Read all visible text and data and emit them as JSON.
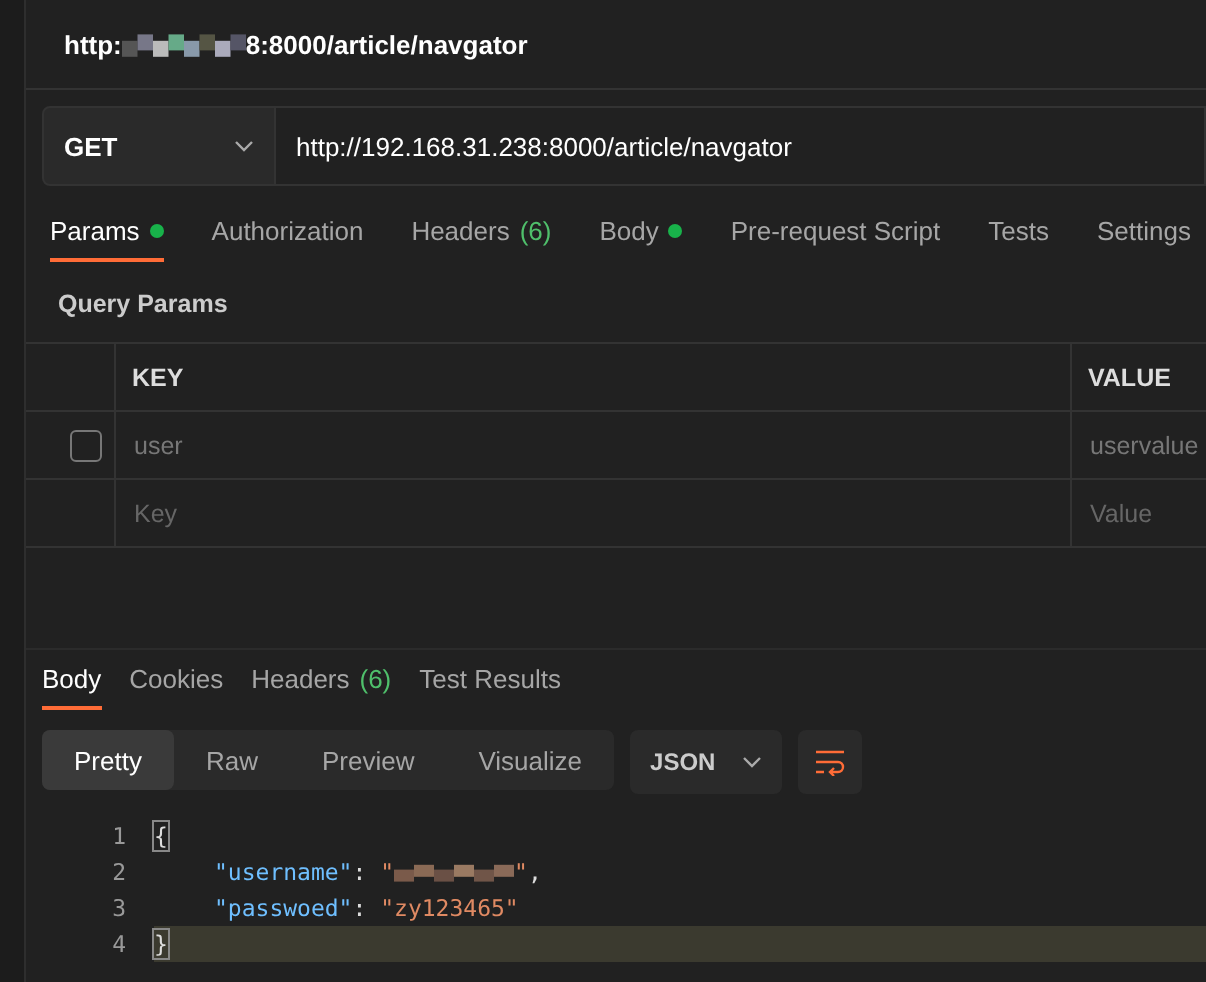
{
  "request_title": {
    "prefix": "http:",
    "suffix": "8:8000/article/navgator"
  },
  "request": {
    "method": "GET",
    "url": "http://192.168.31.238:8000/article/navgator"
  },
  "request_tabs": [
    {
      "label": "Params",
      "dot": true,
      "selected": true
    },
    {
      "label": "Authorization",
      "dot": false,
      "selected": false
    },
    {
      "label": "Headers",
      "count": "(6)",
      "dot": false,
      "selected": false
    },
    {
      "label": "Body",
      "dot": true,
      "selected": false
    },
    {
      "label": "Pre-request Script",
      "dot": false,
      "selected": false
    },
    {
      "label": "Tests",
      "dot": false,
      "selected": false
    },
    {
      "label": "Settings",
      "dot": false,
      "selected": false
    }
  ],
  "query_params": {
    "title": "Query Params",
    "columns": [
      "KEY",
      "VALUE"
    ],
    "rows": [
      {
        "checked": false,
        "key": "user",
        "value": "uservalue"
      }
    ],
    "new_row": {
      "key_placeholder": "Key",
      "value_placeholder": "Value"
    }
  },
  "response_tabs": [
    {
      "label": "Body",
      "selected": true
    },
    {
      "label": "Cookies",
      "selected": false
    },
    {
      "label": "Headers",
      "count": "(6)",
      "selected": false
    },
    {
      "label": "Test Results",
      "selected": false
    }
  ],
  "view_modes": [
    {
      "label": "Pretty",
      "selected": true
    },
    {
      "label": "Raw",
      "selected": false
    },
    {
      "label": "Preview",
      "selected": false
    },
    {
      "label": "Visualize",
      "selected": false
    }
  ],
  "format": "JSON",
  "code_lines": [
    {
      "number": "1",
      "highlighted": false,
      "tokens": [
        {
          "kind": "brace",
          "text": "{"
        }
      ]
    },
    {
      "number": "2",
      "highlighted": false,
      "tokens": [
        {
          "kind": "key",
          "text": "\"username\""
        },
        {
          "kind": "punct",
          "text": ": "
        },
        {
          "kind": "string",
          "text": "\""
        },
        {
          "kind": "redacted"
        },
        {
          "kind": "string",
          "text": "\""
        },
        {
          "kind": "punct",
          "text": ","
        }
      ]
    },
    {
      "number": "3",
      "highlighted": false,
      "tokens": [
        {
          "kind": "key",
          "text": "\"passwoed\""
        },
        {
          "kind": "punct",
          "text": ": "
        },
        {
          "kind": "string",
          "text": "\"zy123465\""
        }
      ]
    },
    {
      "number": "4",
      "highlighted": true,
      "tokens": [
        {
          "kind": "brace",
          "text": "}"
        }
      ]
    }
  ]
}
